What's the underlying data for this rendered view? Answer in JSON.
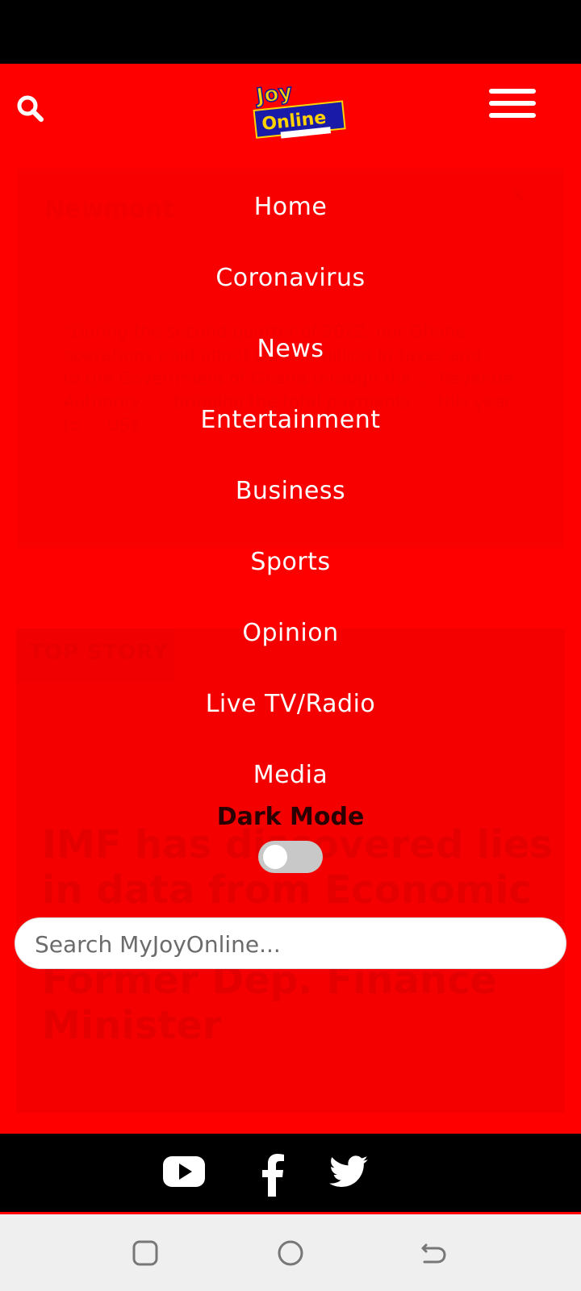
{
  "header": {
    "logo_text_top": "Joy",
    "logo_text_bottom": "Online",
    "search_icon": "search-icon",
    "menu_icon": "hamburger-menu-icon"
  },
  "menu": {
    "items": [
      {
        "label": "Home"
      },
      {
        "label": "Coronavirus"
      },
      {
        "label": "News"
      },
      {
        "label": "Entertainment"
      },
      {
        "label": "Business"
      },
      {
        "label": "Sports"
      },
      {
        "label": "Opinion"
      },
      {
        "label": "Live TV/Radio"
      },
      {
        "label": "Media"
      }
    ],
    "dark_mode_label": "Dark Mode",
    "dark_mode_on": false
  },
  "search": {
    "placeholder": "Search MyJoyOnline...",
    "value": ""
  },
  "background": {
    "card_title": "Newmont",
    "card_close": "×",
    "card_text": "“During the second quarter of 2022, our Ghana operations paid about US$ ... million in taxes and ... to the Government of Ghana through the ... Revenue Authority, ... bringing the total payments ... this year to ... US$",
    "top_story_tag": "TOP STORY",
    "headline": "IMF has discovered lies in data from Economic Management Team - Former Dep. Finance Minister"
  },
  "footer": {
    "social": [
      "youtube-icon",
      "facebook-icon",
      "twitter-icon"
    ]
  },
  "colors": {
    "brand_red": "#fe0000",
    "footer_black": "#000000",
    "text_white": "#ffffff"
  }
}
